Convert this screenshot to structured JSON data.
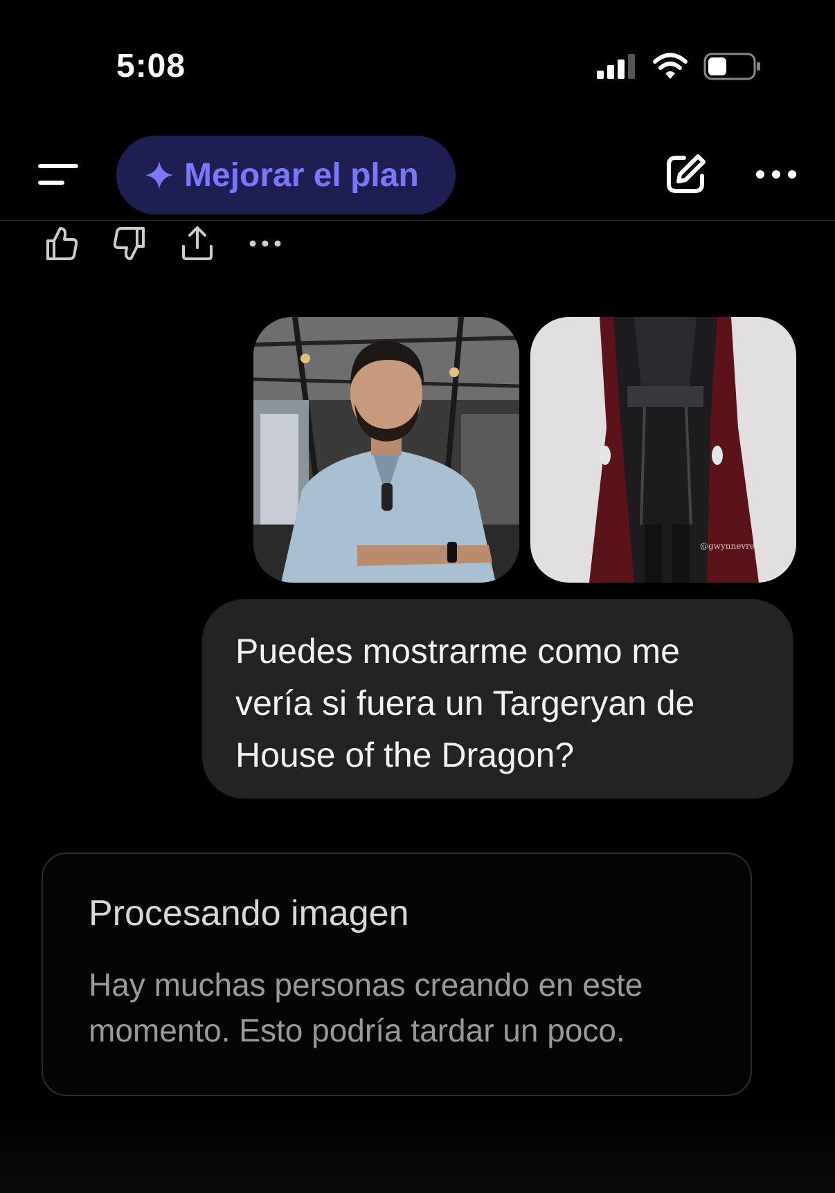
{
  "status_bar": {
    "time": "5:08",
    "icons": [
      "cellular-signal-icon",
      "wifi-icon",
      "battery-icon"
    ]
  },
  "header": {
    "menu_icon": "menu-icon",
    "upgrade_label": "Mejorar el plan",
    "upgrade_icon": "sparkle-icon",
    "compose_icon": "edit-icon",
    "more_icon": "more-icon"
  },
  "message_actions": {
    "icons": [
      "thumbs-up-icon",
      "thumbs-down-icon",
      "share-icon",
      "more-icon"
    ]
  },
  "attachments": [
    {
      "kind": "photo",
      "subject": "man-portrait"
    },
    {
      "kind": "photo",
      "subject": "costume",
      "watermark": "@gwynnevre"
    }
  ],
  "user_message": {
    "text": "Puedes mostrarme como me vería si fuera un Targeryan de House of the Dragon?"
  },
  "processing_card": {
    "title": "Procesando imagen",
    "body": "Hay muchas personas creando en este momento. Esto podría tardar un poco."
  },
  "colors": {
    "background": "#000000",
    "accent": "#7a78ff",
    "pill_bg": "#1e1e52",
    "bubble_bg": "#232323"
  }
}
